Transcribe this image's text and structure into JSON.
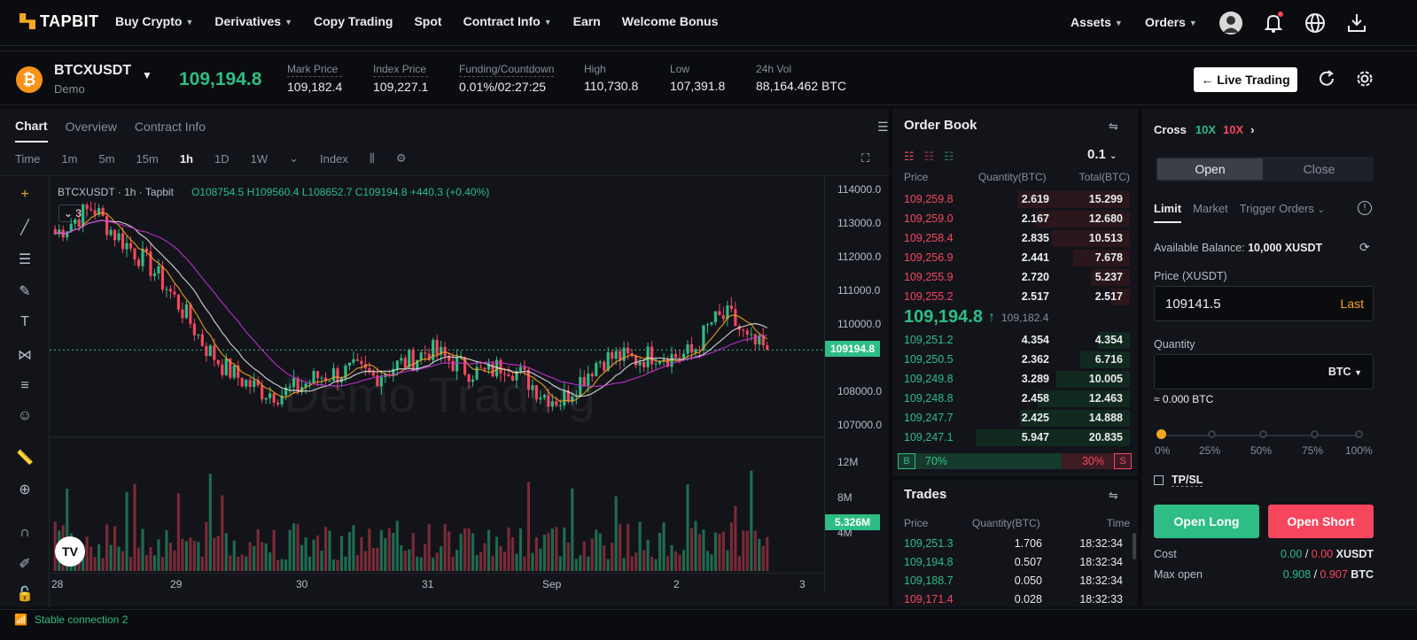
{
  "brand": "TAPBIT",
  "nav": {
    "left": [
      "Buy Crypto",
      "Derivatives",
      "Copy Trading",
      "Spot",
      "Contract Info",
      "Earn",
      "Welcome Bonus"
    ],
    "assets": "Assets",
    "orders": "Orders"
  },
  "ticker": {
    "symbol": "BTCXUSDT",
    "sub": "Demo",
    "last": "109,194.8",
    "stats": [
      {
        "label": "Mark Price",
        "value": "109,182.4"
      },
      {
        "label": "Index Price",
        "value": "109,227.1"
      },
      {
        "label": "Funding/Countdown",
        "value": "0.01%/02:27:25"
      },
      {
        "label": "High",
        "value": "110,730.8"
      },
      {
        "label": "Low",
        "value": "107,391.8"
      },
      {
        "label": "24h Vol",
        "value": "88,164.462 BTC"
      }
    ],
    "live_button": "← Live Trading"
  },
  "chart": {
    "tabs": [
      "Chart",
      "Overview",
      "Contract Info"
    ],
    "timeframes": [
      "Time",
      "1m",
      "5m",
      "15m",
      "1h",
      "1D",
      "1W"
    ],
    "active_tf": "1h",
    "index_label": "Index",
    "legend_symbol": "BTCXUSDT · 1h · Tapbit",
    "ohlc": "O108754.5 H109560.4 L108652.7 C109194.8 +440.3 (+0.40%)",
    "legend_count": "3",
    "watermark": "Demo Trading",
    "price_tag": "109194.8",
    "vol_tag": "5.326M",
    "tv_logo": "TV"
  },
  "chart_data": {
    "type": "line",
    "title": "",
    "xlabel": "",
    "ylabel": "",
    "y_ticks": [
      "114000.0",
      "113000.0",
      "112000.0",
      "111000.0",
      "110000.0",
      "108000.0",
      "107000.0"
    ],
    "volume_ticks": [
      "12M",
      "8M",
      "4M"
    ],
    "x_ticks": [
      "28",
      "29",
      "30",
      "31",
      "Sep",
      "2",
      "3"
    ],
    "ylim": [
      106500,
      114300
    ],
    "close_series": [
      112600,
      113000,
      113400,
      112700,
      112200,
      111700,
      111000,
      110200,
      109300,
      108700,
      108300,
      108000,
      107900,
      108100,
      108400,
      108500,
      108600,
      108400,
      108700,
      108900,
      109200,
      108900,
      108600,
      108500,
      108800,
      108400,
      107900,
      107700,
      108300,
      108900,
      109000,
      108900,
      109100,
      109000,
      109100,
      110000,
      110200,
      109400,
      109195
    ],
    "last_price": 109194.8
  },
  "orderbook": {
    "title": "Order Book",
    "step": "0.1",
    "headers": [
      "Price",
      "Quantity(BTC)",
      "Total(BTC)"
    ],
    "asks": [
      {
        "price": "109,259.8",
        "qty": "2.619",
        "total": "15.299"
      },
      {
        "price": "109,259.0",
        "qty": "2.167",
        "total": "12.680"
      },
      {
        "price": "109,258.4",
        "qty": "2.835",
        "total": "10.513"
      },
      {
        "price": "109,256.9",
        "qty": "2.441",
        "total": "7.678"
      },
      {
        "price": "109,255.9",
        "qty": "2.720",
        "total": "5.237"
      },
      {
        "price": "109,255.2",
        "qty": "2.517",
        "total": "2.517"
      }
    ],
    "mid": "109,194.8",
    "mid_arrow": "↑",
    "mid_mark": "109,182.4",
    "bids": [
      {
        "price": "109,251.2",
        "qty": "4.354",
        "total": "4.354"
      },
      {
        "price": "109,250.5",
        "qty": "2.362",
        "total": "6.716"
      },
      {
        "price": "109,249.8",
        "qty": "3.289",
        "total": "10.005"
      },
      {
        "price": "109,248.8",
        "qty": "2.458",
        "total": "12.463"
      },
      {
        "price": "109,247.7",
        "qty": "2.425",
        "total": "14.888"
      },
      {
        "price": "109,247.1",
        "qty": "5.947",
        "total": "20.835"
      }
    ],
    "buy_label": "B",
    "buy_pct": "70%",
    "buy_ratio": 0.7,
    "sell_pct": "30%",
    "sell_label": "S"
  },
  "trades": {
    "title": "Trades",
    "headers": [
      "Price",
      "Quantity(BTC)",
      "Time"
    ],
    "rows": [
      {
        "price": "109,251.3",
        "qty": "1.706",
        "time": "18:32:34",
        "side": "buy"
      },
      {
        "price": "109,194.8",
        "qty": "0.507",
        "time": "18:32:34",
        "side": "buy"
      },
      {
        "price": "109,188.7",
        "qty": "0.050",
        "time": "18:32:34",
        "side": "buy"
      },
      {
        "price": "109,171.4",
        "qty": "0.028",
        "time": "18:32:33",
        "side": "sell"
      }
    ]
  },
  "order": {
    "cross": "Cross",
    "lev_long": "10X",
    "lev_short": "10X",
    "open": "Open",
    "close": "Close",
    "types": [
      "Limit",
      "Market",
      "Trigger Orders"
    ],
    "balance_label": "Available Balance:",
    "balance_value": "10,000 XUSDT",
    "price_label": "Price (XUSDT)",
    "price_value": "109141.5",
    "last": "Last",
    "qty_label": "Quantity",
    "qty_unit": "BTC",
    "qty_equiv": "≈ 0.000 BTC",
    "slider_marks": [
      "0%",
      "25%",
      "50%",
      "75%",
      "100%"
    ],
    "tpsl": "TP/SL",
    "open_long": "Open Long",
    "open_short": "Open Short",
    "cost_label": "Cost",
    "cost_long": "0.00",
    "cost_short": "0.00",
    "cost_unit": "XUSDT",
    "maxopen_label": "Max open",
    "max_long": "0.908",
    "max_short": "0.907",
    "max_unit": "BTC",
    "slash": "/"
  },
  "status": "Stable connection 2",
  "colors": {
    "up": "#2ebd85",
    "down": "#f6465d",
    "brand": "#f5a623"
  }
}
